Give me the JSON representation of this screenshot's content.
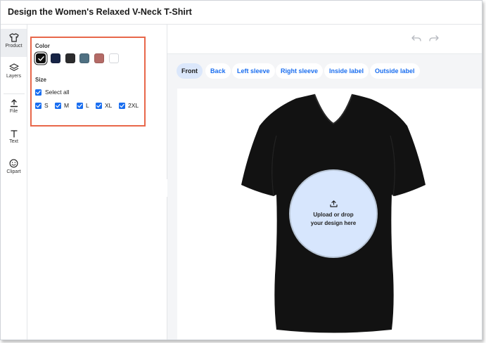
{
  "header": {
    "title": "Design the Women's Relaxed V-Neck T-Shirt"
  },
  "rail": {
    "items": [
      {
        "label": "Product",
        "icon": "tshirt-icon",
        "active": true
      },
      {
        "label": "Layers",
        "icon": "layers-icon"
      },
      {
        "label": "File",
        "icon": "upload-icon"
      },
      {
        "label": "Text",
        "icon": "text-icon"
      },
      {
        "label": "Clipart",
        "icon": "smiley-icon"
      }
    ]
  },
  "panel": {
    "color_label": "Color",
    "colors": [
      {
        "hex": "#111111",
        "selected": true
      },
      {
        "hex": "#172446"
      },
      {
        "hex": "#2b2b2d"
      },
      {
        "hex": "#4f7082"
      },
      {
        "hex": "#b46a66"
      },
      {
        "hex": "#ffffff"
      }
    ],
    "size_label": "Size",
    "select_all": "Select all",
    "sizes": [
      "S",
      "M",
      "L",
      "XL",
      "2XL"
    ]
  },
  "canvas": {
    "tabs": [
      "Front",
      "Back",
      "Left sleeve",
      "Right sleeve",
      "Inside label",
      "Outside label"
    ],
    "active_tab": "Front",
    "upload_line1": "Upload or drop",
    "upload_line2": "your design here"
  },
  "colors": {
    "accent": "#1a6ef0",
    "highlight": "#e8674a",
    "shirt": "#121212"
  }
}
